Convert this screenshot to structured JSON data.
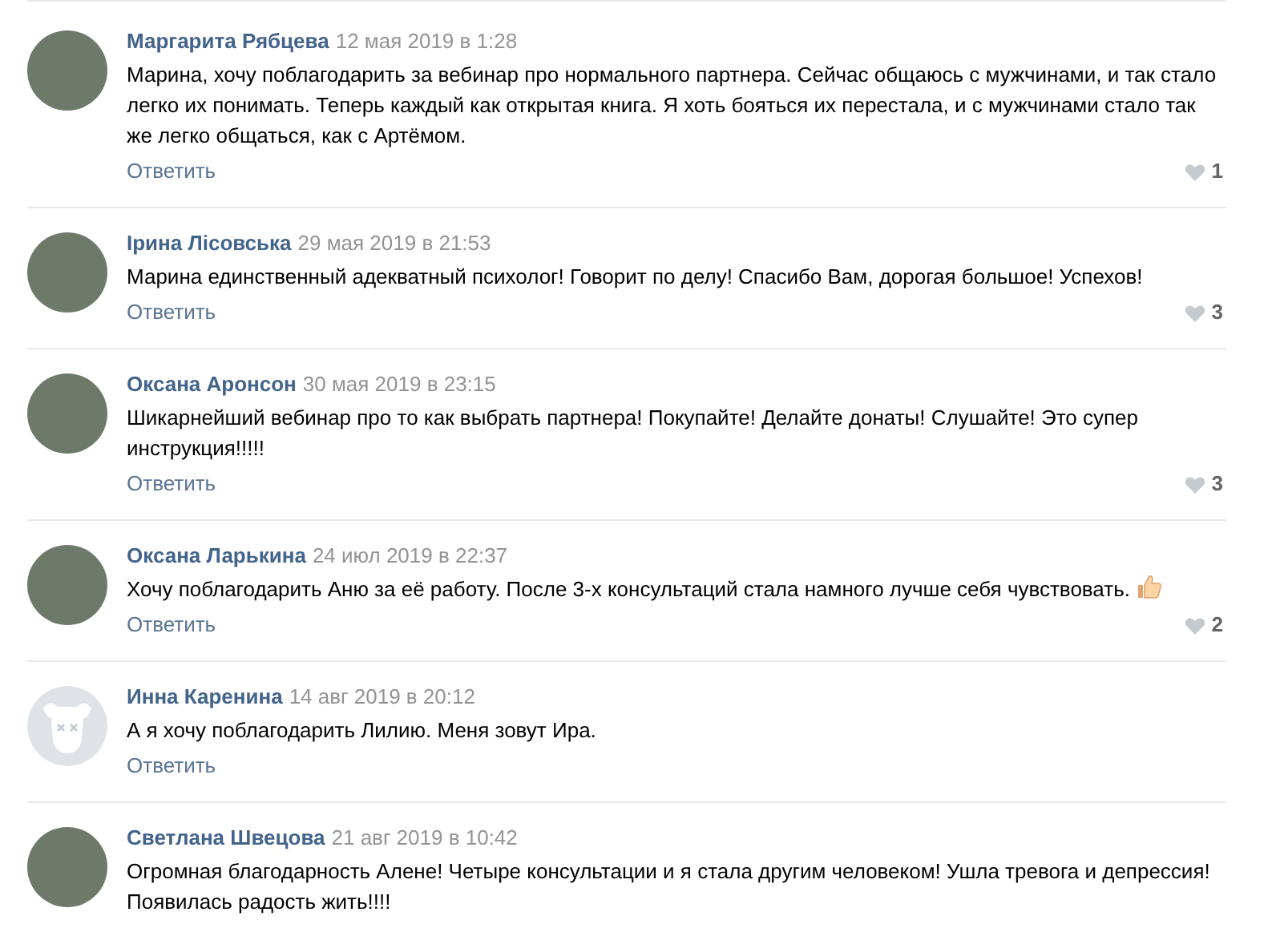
{
  "comments": [
    {
      "author": "Маргарита Рябцева",
      "date": "12 мая 2019 в 1:28",
      "default_avatar": false,
      "text": "Марина, хочу поблагодарить за вебинар про нормального партнера. Сейчас общаюсь с мужчинами, и так стало легко их понимать. Теперь каждый как открытая книга. Я хоть бояться их перестала, и с мужчинами стало так же легко общаться, как с Артёмом.",
      "thumbs_up": false,
      "reply": "Ответить",
      "likes": "1"
    },
    {
      "author": "Ірина Лісовська",
      "date": "29 мая 2019 в 21:53",
      "default_avatar": false,
      "text": "Марина единственный адекватный психолог! Говорит по делу! Спасибо Вам, дорогая большое! Успехов!",
      "thumbs_up": false,
      "reply": "Ответить",
      "likes": "3"
    },
    {
      "author": "Оксана Аронсон",
      "date": "30 мая 2019 в 23:15",
      "default_avatar": false,
      "text": "Шикарнейший вебинар про то как выбрать партнера! Покупайте! Делайте донаты! Слушайте! Это супер инструкция!!!!!",
      "thumbs_up": false,
      "reply": "Ответить",
      "likes": "3"
    },
    {
      "author": "Оксана Ларькина",
      "date": "24 июл 2019 в 22:37",
      "default_avatar": false,
      "text": "Хочу поблагодарить Аню за её работу. После 3-х консультаций стала намного лучше себя чувствовать.",
      "thumbs_up": true,
      "reply": "Ответить",
      "likes": "2"
    },
    {
      "author": "Инна Каренина",
      "date": "14 авг 2019 в 20:12",
      "default_avatar": true,
      "text": "А я хочу поблагодарить Лилию. Меня зовут Ира.",
      "thumbs_up": false,
      "reply": "Ответить"
    },
    {
      "author": "Светлана Швецова",
      "date": "21 авг 2019 в 10:42",
      "default_avatar": false,
      "text": "Огромная благодарность Алене! Четыре консультации и я стала другим человеком! Ушла тревога и депрессия! Появилась радость жить!!!!",
      "thumbs_up": false
    }
  ]
}
